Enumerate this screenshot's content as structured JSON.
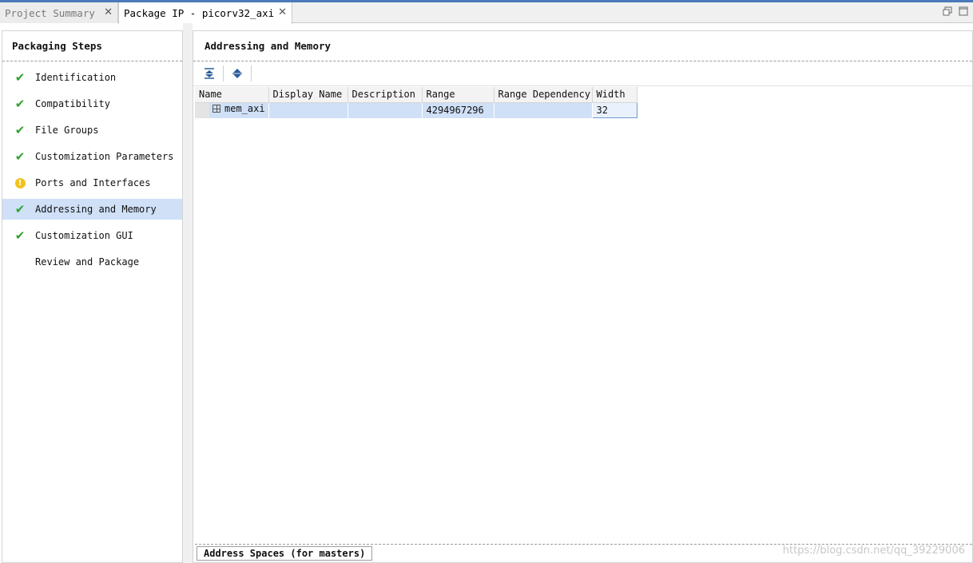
{
  "tabs": [
    {
      "label": "Project Summary",
      "active": false
    },
    {
      "label": "Package IP - picorv32_axi",
      "active": true
    }
  ],
  "tab_close_glyph": "✕",
  "window_controls": {
    "restore_icon": "restore-icon",
    "maximize_icon": "maximize-icon"
  },
  "left_panel": {
    "title": "Packaging Steps",
    "steps": [
      {
        "label": "Identification",
        "status": "check"
      },
      {
        "label": "Compatibility",
        "status": "check"
      },
      {
        "label": "File Groups",
        "status": "check"
      },
      {
        "label": "Customization Parameters",
        "status": "check"
      },
      {
        "label": "Ports and Interfaces",
        "status": "warning"
      },
      {
        "label": "Addressing and Memory",
        "status": "check",
        "selected": true
      },
      {
        "label": "Customization GUI",
        "status": "check"
      },
      {
        "label": "Review and Package",
        "status": "none"
      }
    ]
  },
  "main": {
    "title": "Addressing and Memory",
    "toolbar": {
      "collapse_all_icon": "collapse-all-icon",
      "expand_all_icon": "expand-all-icon"
    },
    "table": {
      "columns": [
        "Name",
        "Display Name",
        "Description",
        "Range",
        "Range Dependency",
        "Width"
      ],
      "rows": [
        {
          "name": "mem_axi",
          "display_name": "",
          "description": "",
          "range": "4294967296",
          "range_dependency": "",
          "width": "32"
        }
      ]
    },
    "bottom_tab": "Address Spaces (for masters)"
  },
  "watermark": "https://blog.csdn.net/qq_39229006",
  "colors": {
    "accent": "#4a7bb8",
    "selection": "#cfe0f7",
    "check": "#2fa32f",
    "warning": "#f1c21b"
  }
}
